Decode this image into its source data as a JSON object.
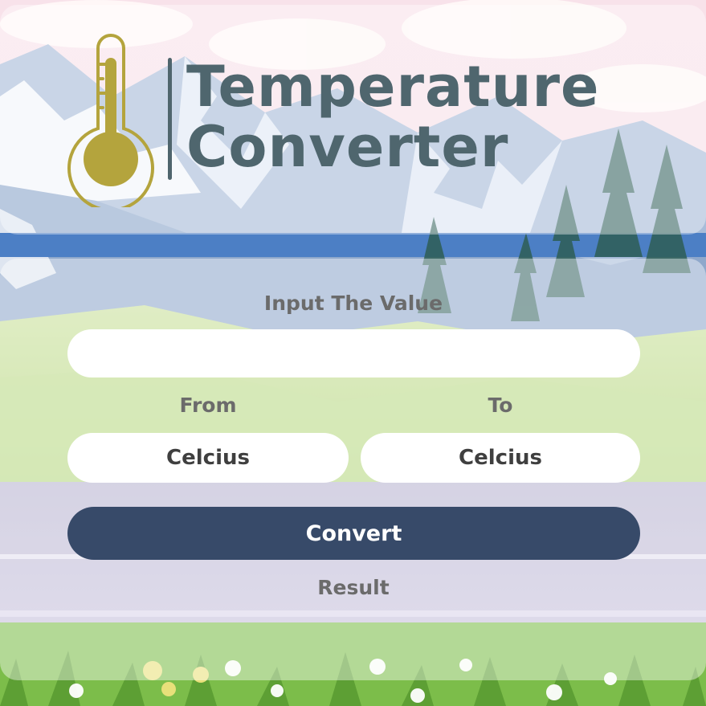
{
  "header": {
    "title_line_1": "Temperature",
    "title_line_2": "Converter",
    "icon": "thermometer-icon"
  },
  "form": {
    "value_label": "Input The Value",
    "value_input": "",
    "from_label": "From",
    "to_label": "To",
    "from_unit": "Celcius",
    "to_unit": "Celcius",
    "convert_label": "Convert",
    "result_label": "Result"
  },
  "colors": {
    "title": "#4f666e",
    "thermometer": "#b4a43d",
    "button": "#374a69",
    "label": "#6b6b6b"
  }
}
